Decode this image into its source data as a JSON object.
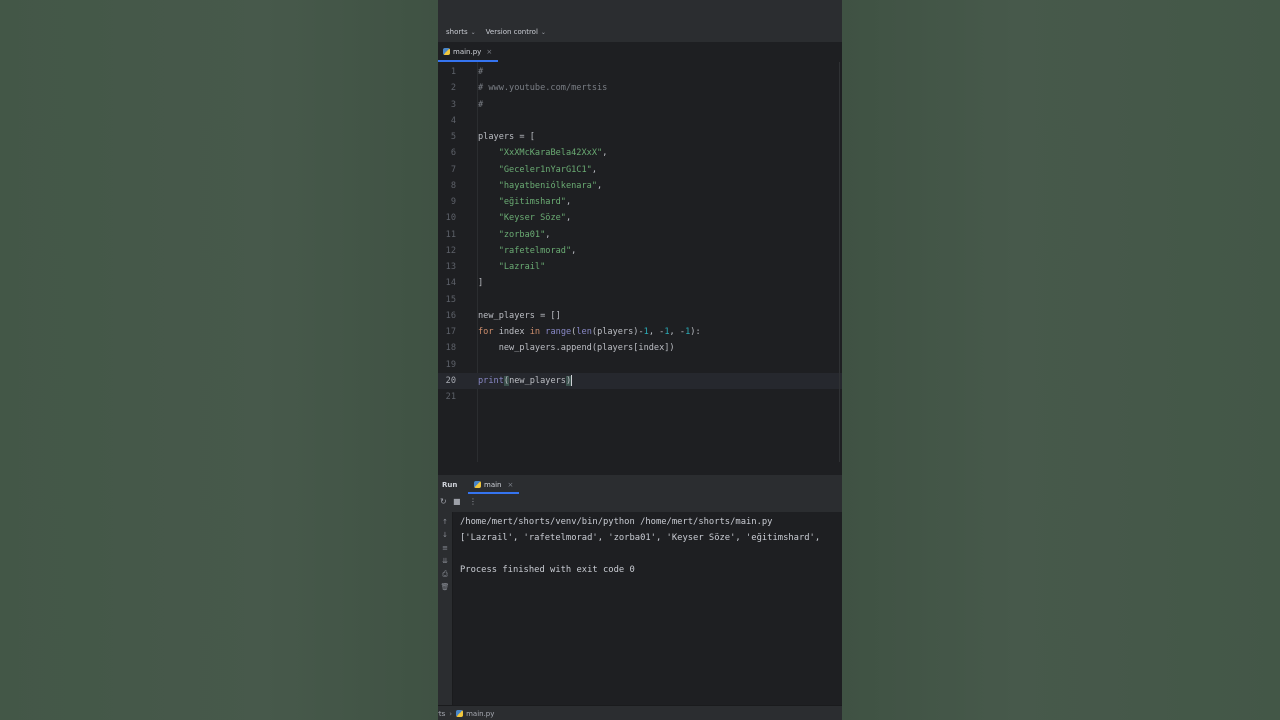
{
  "toolbar": {
    "project": "shorts",
    "vcs": "Version control"
  },
  "editor_tab": {
    "label": "main.py",
    "close": "×"
  },
  "editor": {
    "current_line": 20,
    "lines": [
      {
        "n": "1",
        "parts": [
          {
            "t": "#",
            "c": "comment"
          }
        ]
      },
      {
        "n": "2",
        "parts": [
          {
            "t": "# www.youtube.com/mertsis",
            "c": "comment"
          }
        ]
      },
      {
        "n": "3",
        "parts": [
          {
            "t": "#",
            "c": "comment"
          }
        ]
      },
      {
        "n": "4",
        "parts": []
      },
      {
        "n": "5",
        "parts": [
          {
            "t": "players = [",
            "c": ""
          }
        ]
      },
      {
        "n": "6",
        "parts": [
          {
            "t": "    ",
            "c": ""
          },
          {
            "t": "\"XxXMcKaraBela42XxX\"",
            "c": "str"
          },
          {
            "t": ",",
            "c": ""
          }
        ]
      },
      {
        "n": "7",
        "parts": [
          {
            "t": "    ",
            "c": ""
          },
          {
            "t": "\"Geceler1nYarG1C1\"",
            "c": "str"
          },
          {
            "t": ",",
            "c": ""
          }
        ]
      },
      {
        "n": "8",
        "parts": [
          {
            "t": "    ",
            "c": ""
          },
          {
            "t": "\"hayatbeniólkenara\"",
            "c": "str"
          },
          {
            "t": ",",
            "c": ""
          }
        ]
      },
      {
        "n": "9",
        "parts": [
          {
            "t": "    ",
            "c": ""
          },
          {
            "t": "\"eğitimshard\"",
            "c": "str"
          },
          {
            "t": ",",
            "c": ""
          }
        ]
      },
      {
        "n": "10",
        "parts": [
          {
            "t": "    ",
            "c": ""
          },
          {
            "t": "\"Keyser Söze\"",
            "c": "str"
          },
          {
            "t": ",",
            "c": ""
          }
        ]
      },
      {
        "n": "11",
        "parts": [
          {
            "t": "    ",
            "c": ""
          },
          {
            "t": "\"zorba01\"",
            "c": "str"
          },
          {
            "t": ",",
            "c": ""
          }
        ]
      },
      {
        "n": "12",
        "parts": [
          {
            "t": "    ",
            "c": ""
          },
          {
            "t": "\"rafetelmorad\"",
            "c": "str"
          },
          {
            "t": ",",
            "c": ""
          }
        ]
      },
      {
        "n": "13",
        "parts": [
          {
            "t": "    ",
            "c": ""
          },
          {
            "t": "\"Lazrail\"",
            "c": "str"
          }
        ]
      },
      {
        "n": "14",
        "parts": [
          {
            "t": "]",
            "c": ""
          }
        ]
      },
      {
        "n": "15",
        "parts": []
      },
      {
        "n": "16",
        "parts": [
          {
            "t": "new_players = []",
            "c": ""
          }
        ]
      },
      {
        "n": "17",
        "parts": [
          {
            "t": "for",
            "c": "kw"
          },
          {
            "t": " index ",
            "c": ""
          },
          {
            "t": "in",
            "c": "kw"
          },
          {
            "t": " ",
            "c": ""
          },
          {
            "t": "range",
            "c": "fn"
          },
          {
            "t": "(",
            "c": ""
          },
          {
            "t": "len",
            "c": "fn"
          },
          {
            "t": "(players)-",
            "c": ""
          },
          {
            "t": "1",
            "c": "num"
          },
          {
            "t": ", -",
            "c": ""
          },
          {
            "t": "1",
            "c": "num"
          },
          {
            "t": ", -",
            "c": ""
          },
          {
            "t": "1",
            "c": "num"
          },
          {
            "t": "):",
            "c": ""
          }
        ]
      },
      {
        "n": "18",
        "parts": [
          {
            "t": "    new_players.append(players[index])",
            "c": ""
          }
        ]
      },
      {
        "n": "19",
        "parts": []
      },
      {
        "n": "20",
        "parts": [
          {
            "t": "print",
            "c": "fn"
          },
          {
            "t": "(",
            "c": "paren"
          },
          {
            "t": "new_players",
            "c": ""
          },
          {
            "t": ")",
            "c": "paren"
          },
          {
            "t": "",
            "c": "caret"
          }
        ]
      },
      {
        "n": "21",
        "parts": []
      }
    ]
  },
  "run_panel": {
    "title": "Run",
    "tab_label": "main",
    "tab_close": "×",
    "console": [
      "/home/mert/shorts/venv/bin/python /home/mert/shorts/main.py",
      "['Lazrail', 'rafetelmorad', 'zorba01', 'Keyser Söze', 'eğitimshard',",
      "",
      "Process finished with exit code 0"
    ]
  },
  "statusbar": {
    "project_crumb": "rts",
    "file_crumb": "main.py"
  }
}
